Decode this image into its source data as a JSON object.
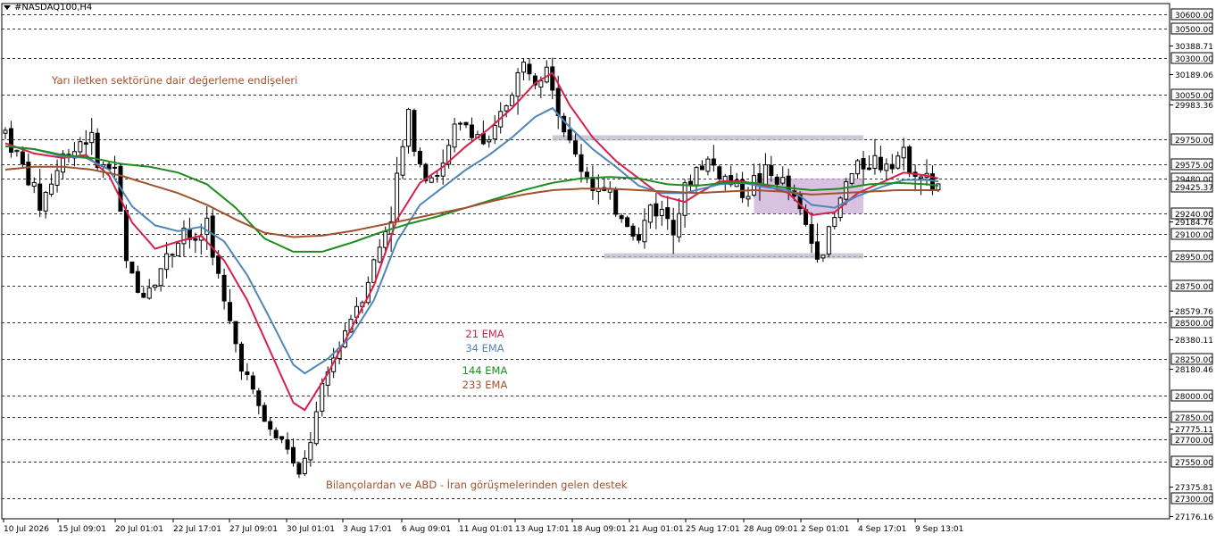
{
  "window": {
    "symbol_label": "#NASDAQ100,H4"
  },
  "colors": {
    "ema21": "#d6204a",
    "ema34": "#4f86b8",
    "ema144": "#1e8c1e",
    "ema233": "#a0522d",
    "annotation": "#a0522d",
    "zone": "#b9b9c9",
    "zone_purple": "#c9a6d6",
    "candle": "#000000",
    "grid": "#000000"
  },
  "annotations": {
    "top": "Yarı iletken sektörüne dair değerleme endişeleri",
    "bottom": "Bilançolardan ve ABD - İran görüşmelerinden gelen destek"
  },
  "legend": [
    {
      "label": "21 EMA",
      "color": "#d6204a"
    },
    {
      "label": "34 EMA",
      "color": "#4f86b8"
    },
    {
      "label": "144 EMA",
      "color": "#1e8c1e"
    },
    {
      "label": "233 EMA",
      "color": "#a0522d"
    }
  ],
  "chart_data": {
    "type": "candlestick",
    "title": "#NASDAQ100,H4",
    "ylim": [
      27176.16,
      30650
    ],
    "grid": "horizontal dashed at level prices",
    "price_axis_levels": [
      30600.0,
      30500.0,
      30300.0,
      30050.0,
      29750.0,
      29575.0,
      29480.0,
      29240.0,
      29100.0,
      28950.0,
      28750.0,
      28500.0,
      28250.0,
      28000.0,
      27850.0,
      27700.0,
      27550.0,
      27300.0
    ],
    "price_axis_levels_text": [
      "30600.00",
      "30500.00",
      "30300.00",
      "30050.00",
      "29750.00",
      "29575.00",
      "29480.00",
      "29240.00",
      "29100.00",
      "28950.00",
      "28750.00",
      "28500.00",
      "28250.00",
      "28000.00",
      "27850.00",
      "27700.00",
      "27550.00",
      "27300.00"
    ],
    "price_axis_ticks": [
      30388.71,
      30189.06,
      29983.36,
      29184.76,
      28579.76,
      28380.11,
      28180.46,
      27775.11,
      27375.81,
      27176.16
    ],
    "price_axis_ticks_text": [
      "30388.71",
      "30189.06",
      "29983.36",
      "29184.76",
      "28579.76",
      "28380.11",
      "28180.46",
      "27775.11",
      "27375.81",
      "27176.16"
    ],
    "current_price": 29425.37,
    "current_price_text": "29425.37",
    "x_tick_labels": [
      "10 Jul 2026",
      "15 Jul 09:01",
      "20 Jul 01:01",
      "22 Jul 17:01",
      "27 Jul 09:01",
      "30 Jul 01:01",
      "3 Aug 17:01",
      "6 Aug 09:01",
      "11 Aug 01:01",
      "13 Aug 17:01",
      "18 Aug 09:01",
      "21 Aug 01:01",
      "25 Aug 17:01",
      "28 Aug 09:01",
      "2 Sep 01:01",
      "4 Sep 17:01",
      "9 Sep 13:01"
    ],
    "close_path": [
      [
        0,
        29800
      ],
      [
        4,
        29480
      ],
      [
        6,
        29300
      ],
      [
        10,
        29620
      ],
      [
        14,
        29780
      ],
      [
        17,
        29550
      ],
      [
        19,
        29560
      ],
      [
        21,
        28900
      ],
      [
        23,
        28700
      ],
      [
        26,
        28800
      ],
      [
        29,
        29000
      ],
      [
        31,
        29150
      ],
      [
        33,
        29000
      ],
      [
        35,
        29200
      ],
      [
        38,
        28600
      ],
      [
        40,
        28350
      ],
      [
        43,
        28000
      ],
      [
        46,
        27750
      ],
      [
        49,
        27650
      ],
      [
        51,
        27400
      ],
      [
        52,
        27550
      ],
      [
        54,
        27850
      ],
      [
        56,
        28150
      ],
      [
        58,
        28350
      ],
      [
        60,
        28550
      ],
      [
        62,
        28700
      ],
      [
        64,
        28900
      ],
      [
        67,
        29250
      ],
      [
        70,
        29900
      ],
      [
        72,
        29600
      ],
      [
        74,
        29500
      ],
      [
        76,
        29550
      ],
      [
        78,
        29800
      ],
      [
        80,
        29850
      ],
      [
        82,
        29780
      ],
      [
        84,
        29680
      ],
      [
        86,
        29900
      ],
      [
        88,
        30100
      ],
      [
        90,
        30250
      ],
      [
        92,
        30200
      ],
      [
        94,
        30300
      ],
      [
        95,
        30150
      ],
      [
        96,
        29950
      ],
      [
        98,
        29700
      ],
      [
        100,
        29560
      ],
      [
        102,
        29450
      ],
      [
        104,
        29350
      ],
      [
        106,
        29280
      ],
      [
        108,
        29200
      ],
      [
        110,
        29050
      ],
      [
        112,
        29300
      ],
      [
        114,
        29250
      ],
      [
        116,
        29200
      ],
      [
        118,
        29380
      ],
      [
        120,
        29550
      ],
      [
        122,
        29600
      ],
      [
        124,
        29520
      ],
      [
        126,
        29450
      ],
      [
        128,
        29400
      ],
      [
        130,
        29450
      ],
      [
        132,
        29500
      ],
      [
        134,
        29480
      ],
      [
        136,
        29400
      ],
      [
        138,
        29250
      ],
      [
        140,
        29050
      ],
      [
        142,
        29000
      ],
      [
        144,
        29200
      ],
      [
        146,
        29450
      ],
      [
        148,
        29550
      ],
      [
        150,
        29620
      ],
      [
        152,
        29580
      ],
      [
        154,
        29650
      ],
      [
        156,
        29620
      ],
      [
        158,
        29560
      ],
      [
        160,
        29450
      ],
      [
        162,
        29420
      ]
    ],
    "hlc_path": [
      [
        0,
        29850,
        29750
      ],
      [
        21,
        29600,
        28550
      ],
      [
        38,
        29350,
        28000
      ],
      [
        51,
        28050,
        27250
      ],
      [
        52,
        27700,
        27360
      ],
      [
        60,
        28700,
        28100
      ],
      [
        70,
        30050,
        29300
      ],
      [
        88,
        30200,
        29800
      ],
      [
        95,
        30350,
        29900
      ],
      [
        104,
        29750,
        29150
      ],
      [
        110,
        29460,
        28950
      ],
      [
        122,
        29760,
        29350
      ],
      [
        140,
        29520,
        28930
      ],
      [
        148,
        29720,
        29300
      ],
      [
        162,
        29550,
        29350
      ]
    ],
    "series": [
      {
        "name": "21 EMA",
        "points": [
          [
            0,
            29720
          ],
          [
            5,
            29650
          ],
          [
            10,
            29620
          ],
          [
            14,
            29640
          ],
          [
            18,
            29500
          ],
          [
            22,
            29180
          ],
          [
            26,
            29000
          ],
          [
            30,
            29050
          ],
          [
            34,
            29090
          ],
          [
            38,
            28920
          ],
          [
            42,
            28650
          ],
          [
            46,
            28300
          ],
          [
            50,
            27950
          ],
          [
            52,
            27900
          ],
          [
            56,
            28150
          ],
          [
            60,
            28450
          ],
          [
            64,
            28750
          ],
          [
            68,
            29200
          ],
          [
            72,
            29450
          ],
          [
            76,
            29560
          ],
          [
            80,
            29700
          ],
          [
            84,
            29820
          ],
          [
            88,
            29960
          ],
          [
            92,
            30130
          ],
          [
            95,
            30200
          ],
          [
            98,
            29980
          ],
          [
            102,
            29760
          ],
          [
            106,
            29600
          ],
          [
            110,
            29480
          ],
          [
            114,
            29360
          ],
          [
            118,
            29320
          ],
          [
            120,
            29370
          ],
          [
            124,
            29460
          ],
          [
            128,
            29460
          ],
          [
            132,
            29430
          ],
          [
            136,
            29380
          ],
          [
            138,
            29300
          ],
          [
            140,
            29230
          ],
          [
            144,
            29250
          ],
          [
            148,
            29380
          ],
          [
            152,
            29450
          ],
          [
            156,
            29520
          ],
          [
            160,
            29500
          ],
          [
            162,
            29480
          ]
        ]
      },
      {
        "name": "34 EMA",
        "points": [
          [
            0,
            29700
          ],
          [
            5,
            29680
          ],
          [
            10,
            29630
          ],
          [
            14,
            29620
          ],
          [
            18,
            29540
          ],
          [
            22,
            29290
          ],
          [
            26,
            29160
          ],
          [
            30,
            29120
          ],
          [
            34,
            29150
          ],
          [
            38,
            29050
          ],
          [
            42,
            28820
          ],
          [
            46,
            28520
          ],
          [
            50,
            28210
          ],
          [
            52,
            28150
          ],
          [
            56,
            28250
          ],
          [
            60,
            28400
          ],
          [
            64,
            28650
          ],
          [
            68,
            29050
          ],
          [
            72,
            29300
          ],
          [
            76,
            29420
          ],
          [
            80,
            29540
          ],
          [
            84,
            29640
          ],
          [
            88,
            29760
          ],
          [
            92,
            29900
          ],
          [
            95,
            29960
          ],
          [
            98,
            29830
          ],
          [
            102,
            29680
          ],
          [
            106,
            29560
          ],
          [
            110,
            29430
          ],
          [
            114,
            29380
          ],
          [
            118,
            29380
          ],
          [
            120,
            29400
          ],
          [
            124,
            29440
          ],
          [
            128,
            29450
          ],
          [
            132,
            29420
          ],
          [
            136,
            29400
          ],
          [
            138,
            29360
          ],
          [
            140,
            29300
          ],
          [
            144,
            29280
          ],
          [
            148,
            29360
          ],
          [
            152,
            29420
          ],
          [
            156,
            29470
          ],
          [
            160,
            29470
          ],
          [
            162,
            29460
          ]
        ]
      },
      {
        "name": "144 EMA",
        "points": [
          [
            0,
            29700
          ],
          [
            5,
            29680
          ],
          [
            10,
            29640
          ],
          [
            15,
            29620
          ],
          [
            20,
            29580
          ],
          [
            25,
            29560
          ],
          [
            30,
            29520
          ],
          [
            35,
            29440
          ],
          [
            40,
            29280
          ],
          [
            45,
            29070
          ],
          [
            50,
            28980
          ],
          [
            55,
            28980
          ],
          [
            60,
            29040
          ],
          [
            65,
            29110
          ],
          [
            70,
            29170
          ],
          [
            75,
            29220
          ],
          [
            80,
            29280
          ],
          [
            85,
            29340
          ],
          [
            90,
            29400
          ],
          [
            95,
            29450
          ],
          [
            100,
            29480
          ],
          [
            105,
            29490
          ],
          [
            110,
            29480
          ],
          [
            115,
            29440
          ],
          [
            120,
            29430
          ],
          [
            125,
            29450
          ],
          [
            130,
            29450
          ],
          [
            135,
            29420
          ],
          [
            140,
            29400
          ],
          [
            145,
            29410
          ],
          [
            150,
            29440
          ],
          [
            155,
            29450
          ],
          [
            160,
            29440
          ],
          [
            162,
            29430
          ]
        ]
      },
      {
        "name": "233 EMA",
        "points": [
          [
            0,
            29540
          ],
          [
            5,
            29560
          ],
          [
            10,
            29560
          ],
          [
            15,
            29540
          ],
          [
            20,
            29500
          ],
          [
            25,
            29440
          ],
          [
            30,
            29380
          ],
          [
            35,
            29300
          ],
          [
            40,
            29200
          ],
          [
            45,
            29110
          ],
          [
            50,
            29080
          ],
          [
            55,
            29090
          ],
          [
            60,
            29120
          ],
          [
            65,
            29160
          ],
          [
            70,
            29200
          ],
          [
            75,
            29240
          ],
          [
            80,
            29280
          ],
          [
            85,
            29330
          ],
          [
            90,
            29370
          ],
          [
            95,
            29400
          ],
          [
            100,
            29410
          ],
          [
            105,
            29410
          ],
          [
            110,
            29400
          ],
          [
            115,
            29390
          ],
          [
            120,
            29380
          ],
          [
            125,
            29390
          ],
          [
            130,
            29400
          ],
          [
            135,
            29390
          ],
          [
            140,
            29370
          ],
          [
            145,
            29380
          ],
          [
            150,
            29390
          ],
          [
            155,
            29400
          ],
          [
            160,
            29400
          ],
          [
            162,
            29400
          ]
        ]
      }
    ],
    "zones": [
      {
        "kind": "resistance",
        "from": 95,
        "to": 149,
        "low": 29740,
        "high": 29775
      },
      {
        "kind": "support",
        "from": 104,
        "to": 149,
        "low": 28935,
        "high": 28970
      },
      {
        "kind": "range",
        "from": 130,
        "to": 149,
        "low": 29240,
        "high": 29480
      }
    ]
  }
}
